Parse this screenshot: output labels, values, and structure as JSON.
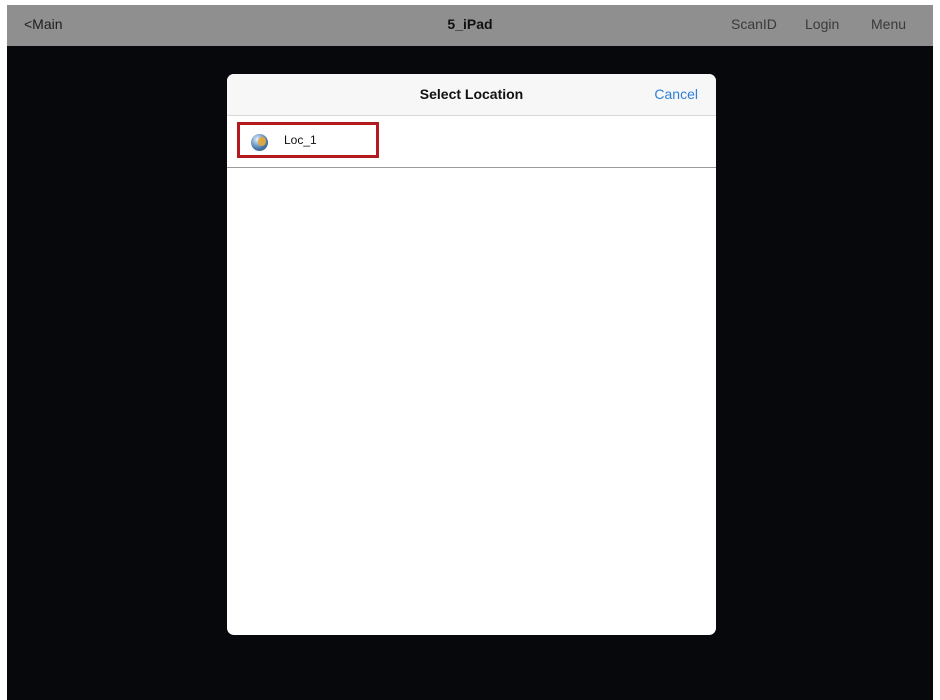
{
  "navbar": {
    "back_label": "<Main",
    "title": "5_iPad",
    "scan_label": "ScanID",
    "login_label": "Login",
    "menu_label": "Menu"
  },
  "modal": {
    "title": "Select Location",
    "cancel_label": "Cancel",
    "items": [
      {
        "label": "Loc_1",
        "icon": "globe-icon"
      }
    ]
  },
  "colors": {
    "background": "#06080c",
    "navbar": "#8f8f8f",
    "accent": "#2f7fd6",
    "highlight": "#b3191f"
  }
}
